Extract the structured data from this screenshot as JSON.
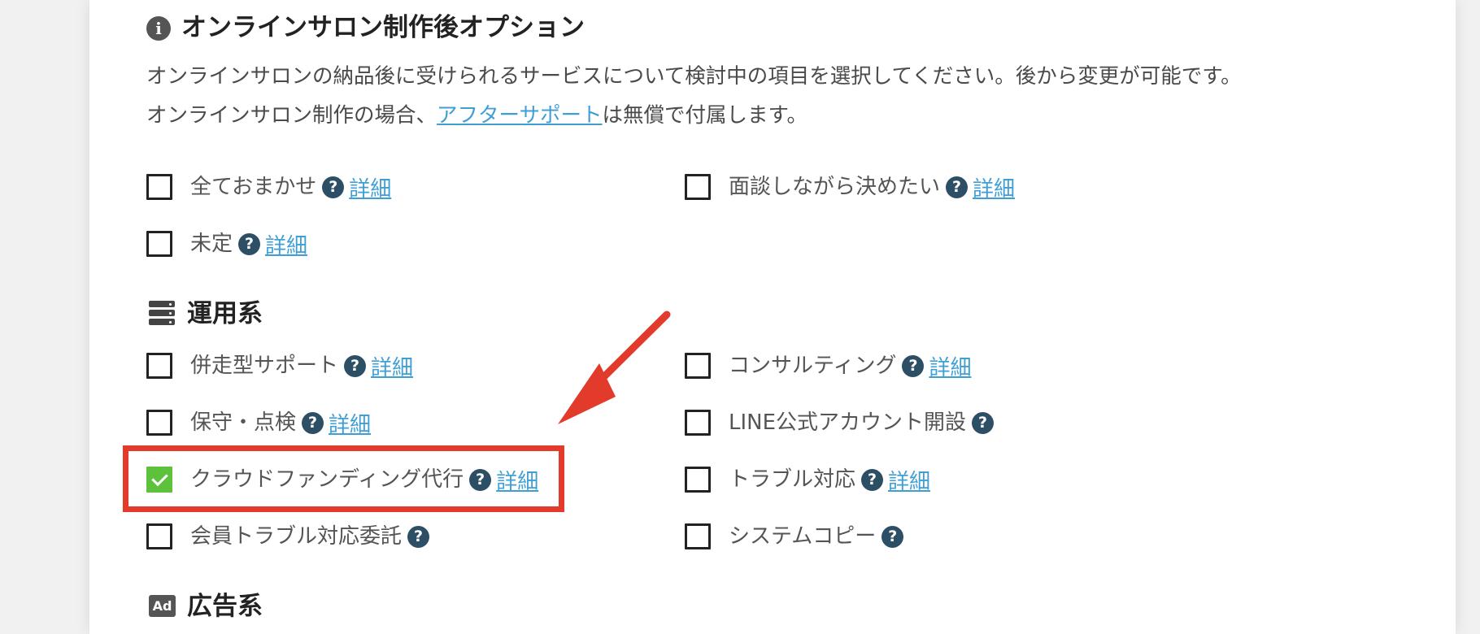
{
  "section": {
    "title": "オンラインサロン制作後オプション",
    "desc_line1": "オンラインサロンの納品後に受けられるサービスについて検討中の項目を選択してください。後から変更が可能です。",
    "desc_line2_before": "オンラインサロン制作の場合、",
    "desc_line2_link": "アフターサポート",
    "desc_line2_after": "は無償で付属します。"
  },
  "general_options": [
    {
      "label": "全ておまかせ",
      "detail": "詳細",
      "checked": false
    },
    {
      "label": "面談しながら決めたい",
      "detail": "詳細",
      "checked": false
    },
    {
      "label": "未定",
      "detail": "詳細",
      "checked": false
    }
  ],
  "operations": {
    "title": "運用系",
    "options": [
      {
        "label": "併走型サポート",
        "detail": "詳細",
        "checked": false
      },
      {
        "label": "コンサルティング",
        "detail": "詳細",
        "checked": false
      },
      {
        "label": "保守・点検",
        "detail": "詳細",
        "checked": false
      },
      {
        "label": "LINE公式アカウント開設",
        "checked": false
      },
      {
        "label": "クラウドファンディング代行",
        "detail": "詳細",
        "checked": true
      },
      {
        "label": "トラブル対応",
        "detail": "詳細",
        "checked": false
      },
      {
        "label": "会員トラブル対応委託",
        "checked": false
      },
      {
        "label": "システムコピー",
        "checked": false
      }
    ]
  },
  "advertising": {
    "title": "広告系",
    "icon_text": "Ad"
  },
  "help_glyph": "?",
  "info_glyph": "i",
  "icons": {
    "info": "info-circle-icon",
    "help": "question-circle-icon",
    "server": "server-icon",
    "ad": "ad-icon",
    "check": "check-icon"
  },
  "colors": {
    "link": "#3f9fd4",
    "help_icon": "#2d4f66",
    "checked": "#5cc13b",
    "highlight": "#e23a2b"
  }
}
